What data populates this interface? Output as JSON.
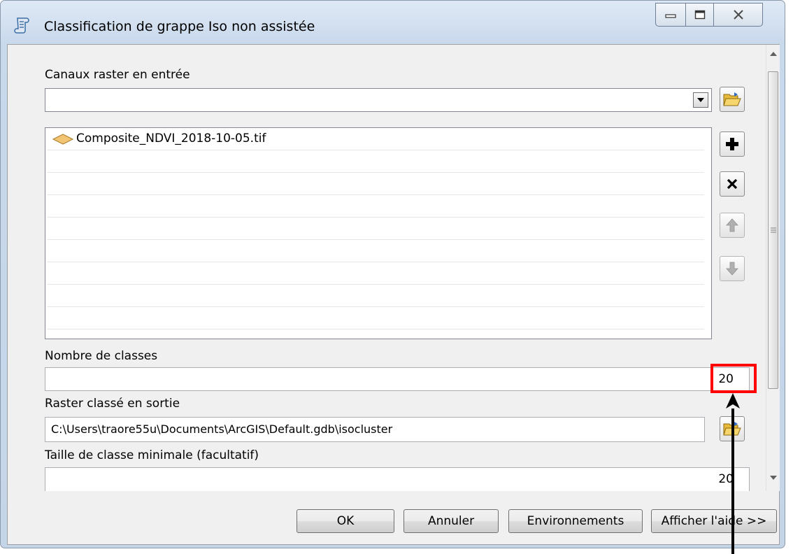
{
  "window": {
    "title": "Classification de grappe Iso non assistée",
    "icon": "script-tool-icon"
  },
  "inputs": {
    "raster_bands_label": "Canaux raster en entrée",
    "raster_bands_value": "",
    "raster_list": [
      "Composite_NDVI_2018-10-05.tif"
    ],
    "num_classes_label": "Nombre de classes",
    "num_classes_value": "20",
    "output_label": "Raster classé en sortie",
    "output_value": "C:\\Users\\traore55u\\Documents\\ArcGIS\\Default.gdb\\isocluster",
    "min_class_label": "Taille de classe minimale (facultatif)",
    "min_class_value": "20"
  },
  "side_buttons": [
    "folder-open-icon",
    "add-icon",
    "remove-icon",
    "move-up-icon",
    "move-down-icon"
  ],
  "buttons": {
    "ok": "OK",
    "cancel": "Annuler",
    "environments": "Environnements",
    "help": "Afficher l'aide >>"
  },
  "colors": {
    "highlight": "#ff0000",
    "raster_icon": "#f2c575",
    "folder": "#e8b93a"
  }
}
